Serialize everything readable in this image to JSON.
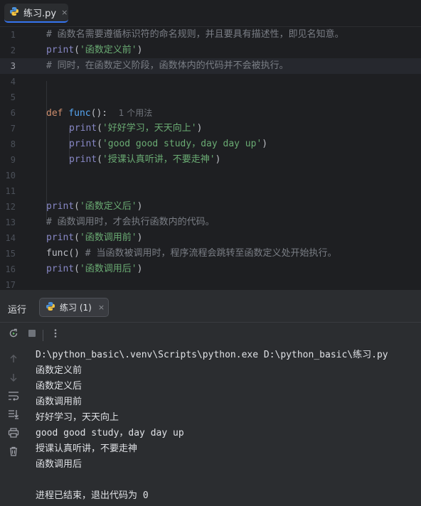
{
  "editor_tab": {
    "label": "练习.py",
    "close_glyph": "×"
  },
  "editor": {
    "current_line": 3,
    "usage_hint": "1 个用法",
    "line_numbers": [
      "1",
      "2",
      "3",
      "4",
      "5",
      "6",
      "7",
      "8",
      "9",
      "10",
      "11",
      "12",
      "13",
      "14",
      "15",
      "16",
      "17"
    ],
    "lines": {
      "l1": "# 函数名需要遵循标识符的命名规则，并且要具有描述性，即见名知意。",
      "l2_fn": "print",
      "l2_str": "'函数定义前'",
      "l3": "# 同时，在函数定义阶段，函数体内的代码并不会被执行。",
      "l6_kw": "def",
      "l6_name": "func",
      "l6_rest": "():",
      "l7_fn": "print",
      "l7_str": "'好好学习，天天向上'",
      "l8_fn": "print",
      "l8_str": "'good good study，day day up'",
      "l9_fn": "print",
      "l9_str": "'授课认真听讲，不要走神'",
      "l12_fn": "print",
      "l12_str": "'函数定义后'",
      "l13": "# 函数调用时，才会执行函数内的代码。",
      "l14_fn": "print",
      "l14_str": "'函数调用前'",
      "l15_call": "func()",
      "l15_cmt": "# 当函数被调用时，程序流程会跳转至函数定义处开始执行。",
      "l16_fn": "print",
      "l16_str": "'函数调用后'"
    }
  },
  "run_panel": {
    "title": "运行",
    "tab_label": "练习 (1)",
    "close_glyph": "×",
    "console_lines": [
      "D:\\python_basic\\.venv\\Scripts\\python.exe D:\\python_basic\\练习.py",
      "函数定义前",
      "函数定义后",
      "函数调用前",
      "好好学习，天天向上",
      "good good study，day day up",
      "授课认真听讲，不要走神",
      "函数调用后",
      "",
      "进程已结束，退出代码为 0"
    ]
  },
  "colors": {
    "background": "#1e1f22",
    "comment": "#7a7e85",
    "keyword": "#cf8e6d",
    "function": "#56a8f5",
    "builtin": "#8888c6",
    "string": "#6aab73",
    "accent": "#3574f0"
  },
  "icons": [
    "python-file-icon",
    "rerun-icon",
    "stop-icon",
    "more-icon",
    "scroll-up-icon",
    "scroll-down-icon",
    "soft-wrap-icon",
    "scroll-to-end-icon",
    "print-icon",
    "trash-icon"
  ]
}
